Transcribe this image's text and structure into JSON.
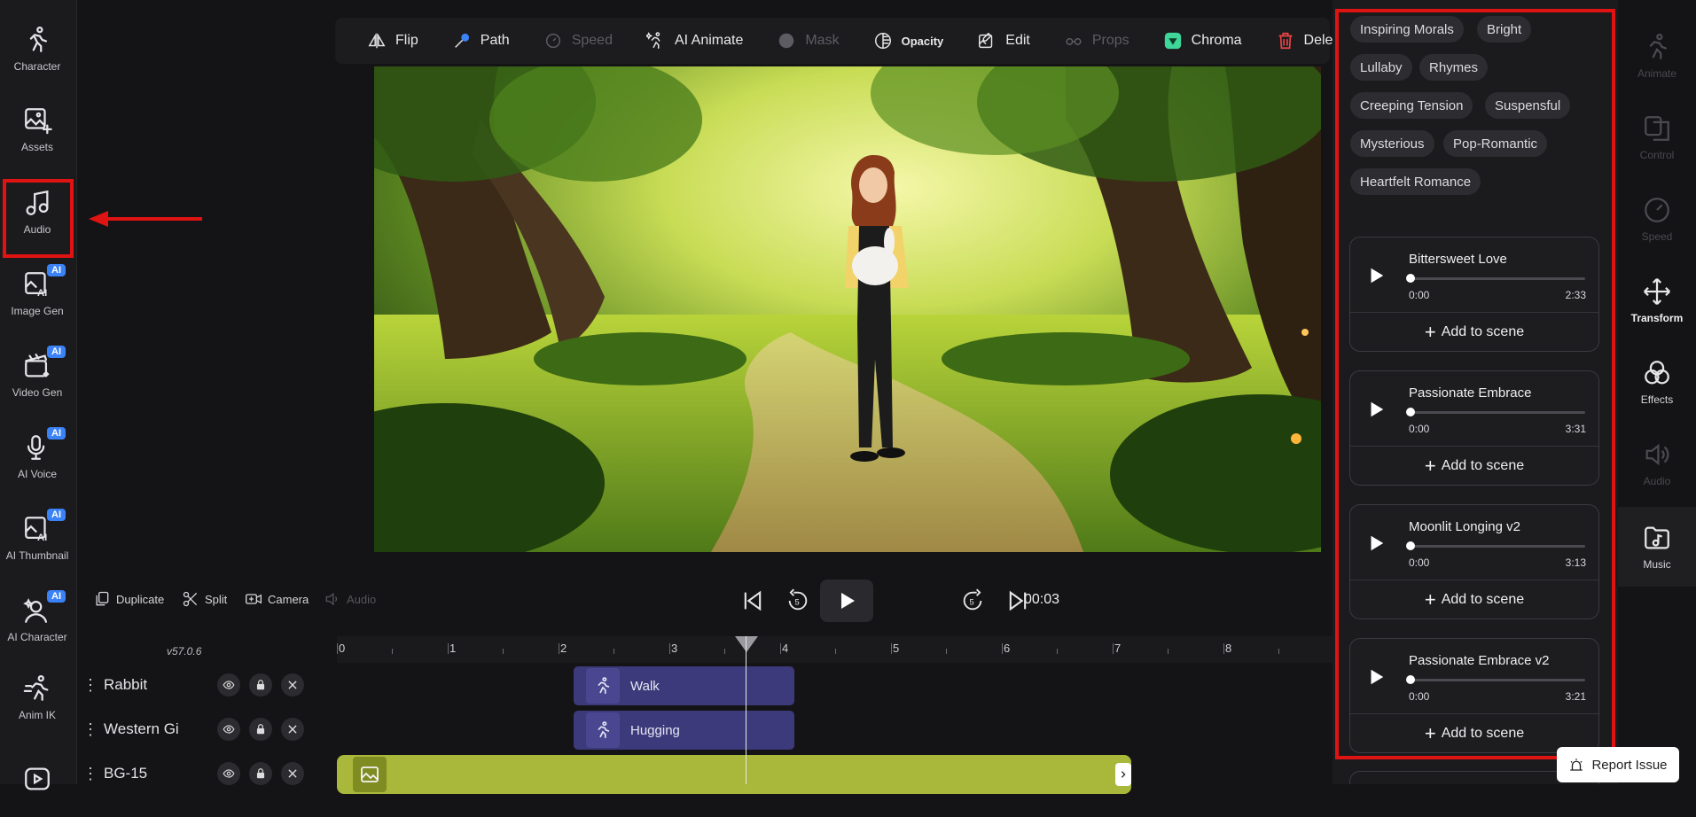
{
  "left_sidebar": {
    "items": [
      {
        "label": "Character",
        "ai": false
      },
      {
        "label": "Assets",
        "ai": false
      },
      {
        "label": "Audio",
        "ai": false
      },
      {
        "label": "Image Gen",
        "ai": true
      },
      {
        "label": "Video Gen",
        "ai": true
      },
      {
        "label": "AI Voice",
        "ai": true
      },
      {
        "label": "AI Thumbnail",
        "ai": true
      },
      {
        "label": "AI Character",
        "ai": true
      },
      {
        "label": "Anim IK",
        "ai": false
      }
    ],
    "ai_badge": "AI"
  },
  "toolbar": {
    "flip": "Flip",
    "path": "Path",
    "speed": "Speed",
    "ai_animate": "AI Animate",
    "mask": "Mask",
    "opacity": "Opacity",
    "edit": "Edit",
    "props": "Props",
    "chroma": "Chroma",
    "delete": "Delete"
  },
  "playback": {
    "duplicate": "Duplicate",
    "split": "Split",
    "camera": "Camera",
    "audio": "Audio",
    "skip_back": "5",
    "skip_forward": "5",
    "time": "00:03"
  },
  "timeline": {
    "version": "v57.0.6",
    "ticks": [
      "0",
      "1",
      "2",
      "3",
      "4",
      "5",
      "6",
      "7",
      "8"
    ],
    "tracks": [
      {
        "name": "Rabbit",
        "clip": "Walk"
      },
      {
        "name": "Western Gi",
        "clip": "Hugging"
      },
      {
        "name": "BG-15",
        "clip": ""
      }
    ]
  },
  "music_panel": {
    "tags": [
      "Inspiring Morals",
      "Bright",
      "Lullaby",
      "Rhymes",
      "Creeping Tension",
      "Suspensful",
      "Mysterious",
      "Pop-Romantic",
      "Heartfelt Romance"
    ],
    "add_label": "Add to scene",
    "tracks": [
      {
        "title": "Bittersweet Love",
        "current": "0:00",
        "duration": "2:33",
        "progress": 0
      },
      {
        "title": "Passionate Embrace",
        "current": "0:00",
        "duration": "3:31",
        "progress": 0
      },
      {
        "title": "Moonlit Longing v2",
        "current": "0:00",
        "duration": "3:13",
        "progress": 0
      },
      {
        "title": "Passionate Embrace v2",
        "current": "0:00",
        "duration": "3:21",
        "progress": 0
      }
    ]
  },
  "right_rail": {
    "items": [
      "Animate",
      "Control",
      "Speed",
      "Transform",
      "Effects",
      "Audio",
      "Music"
    ]
  },
  "report_issue": "Report Issue",
  "colors": {
    "highlight": "#e01313",
    "ai_badge": "#3b82f6",
    "clip": "#3c3a7a",
    "bg_track": "#a9b83a",
    "chroma": "#3fd69a",
    "delete": "#ef4444"
  }
}
